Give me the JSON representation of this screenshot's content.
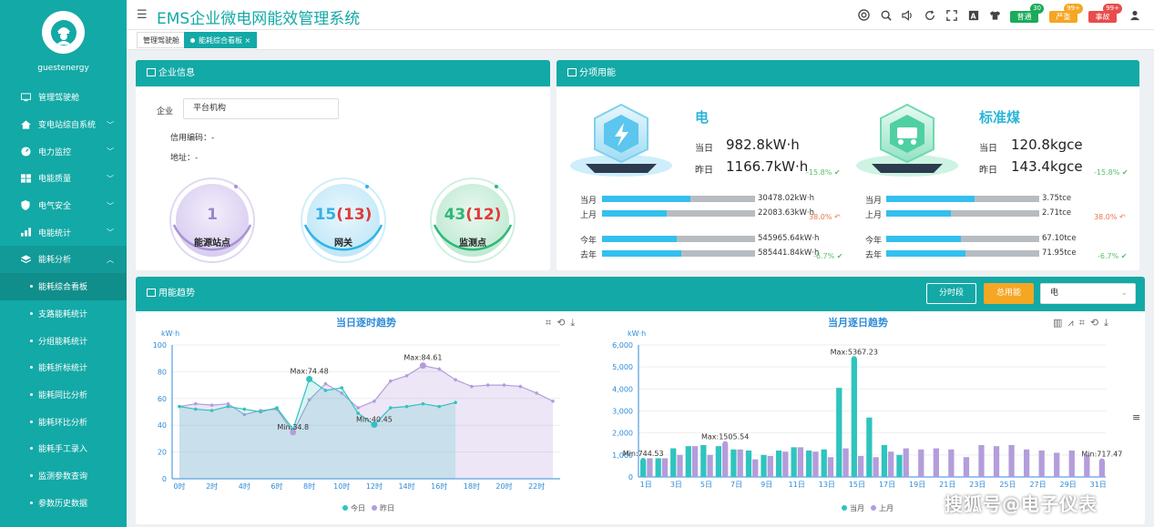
{
  "user": {
    "name": "guestenergy"
  },
  "app": {
    "title": "EMS企业微电网能效管理系统"
  },
  "topbar": {
    "badges": [
      {
        "label": "普通",
        "count": "30",
        "color": "#1aab5a",
        "count_color": "#1aab5a"
      },
      {
        "label": "严重",
        "count": "99+",
        "color": "#f5a623",
        "count_color": "#f5a623"
      },
      {
        "label": "事故",
        "count": "99+",
        "color": "#e84c4c",
        "count_color": "#e84c4c"
      }
    ]
  },
  "sidebar": {
    "items": [
      {
        "label": "管理驾驶舱",
        "icon": "monitor-icon"
      },
      {
        "label": "变电站综自系统",
        "icon": "home-icon"
      },
      {
        "label": "电力监控",
        "icon": "gauge-icon"
      },
      {
        "label": "电能质量",
        "icon": "grid-icon"
      },
      {
        "label": "电气安全",
        "icon": "shield-icon"
      },
      {
        "label": "电能统计",
        "icon": "bar-chart-icon"
      },
      {
        "label": "能耗分析",
        "icon": "layers-icon"
      }
    ],
    "subitems": [
      {
        "label": "能耗综合看板",
        "active": true
      },
      {
        "label": "支路能耗统计"
      },
      {
        "label": "分组能耗统计"
      },
      {
        "label": "能耗折标统计"
      },
      {
        "label": "能耗同比分析"
      },
      {
        "label": "能耗环比分析"
      },
      {
        "label": "能耗手工录入"
      },
      {
        "label": "监测参数查询"
      },
      {
        "label": "参数历史数据"
      }
    ]
  },
  "tabs": [
    {
      "label": "管理驾驶舱"
    },
    {
      "label": "能耗综合看板",
      "close": "×"
    }
  ],
  "company_panel": {
    "title": "企业信息",
    "company_label": "企业",
    "company_value": "平台机构",
    "credit_label": "信用编码：-",
    "address_label": "地址：-",
    "stats": [
      {
        "value": "1",
        "extra": "",
        "label": "能源站点",
        "color": "#9b86cf"
      },
      {
        "value": "15",
        "extra": "(13)",
        "label": "网关",
        "color": "#2fb3e8"
      },
      {
        "value": "43",
        "extra": "(12)",
        "label": "监测点",
        "color": "#2fb77a"
      }
    ]
  },
  "category_panel": {
    "title": "分项用能",
    "electricity": {
      "title": "电",
      "today_label": "当日",
      "today_value": "982.8kW·h",
      "yesterday_label": "昨日",
      "yesterday_value": "1166.7kW·h",
      "day_pct": "-15.8%",
      "month_label": "当月",
      "month_value": "30478.02kW·h",
      "month_fill": 0.58,
      "last_month_label": "上月",
      "last_month_value": "22083.63kW·h",
      "last_month_fill": 0.42,
      "month_pct": "38.0%",
      "year_label": "今年",
      "year_value": "545965.64kW·h",
      "year_fill": 0.49,
      "last_year_label": "去年",
      "last_year_value": "585441.84kW·h",
      "last_year_fill": 0.52,
      "year_pct": "-6.7%"
    },
    "coal": {
      "title": "标准煤",
      "today_label": "当日",
      "today_value": "120.8kgce",
      "yesterday_label": "昨日",
      "yesterday_value": "143.4kgce",
      "day_pct": "-15.8%",
      "month_label": "当月",
      "month_value": "3.75tce",
      "month_fill": 0.58,
      "last_month_label": "上月",
      "last_month_value": "2.71tce",
      "last_month_fill": 0.42,
      "month_pct": "38.0%",
      "year_label": "今年",
      "year_value": "67.10tce",
      "year_fill": 0.49,
      "last_year_label": "去年",
      "last_year_value": "71.95tce",
      "last_year_fill": 0.52,
      "year_pct": "-6.7%"
    }
  },
  "trend_panel": {
    "title": "用能趋势",
    "btn_period": "分时段",
    "btn_total": "总用能",
    "select_value": "电"
  },
  "chart_data": [
    {
      "type": "line",
      "title": "当日逐时趋势",
      "ylabel": "kW·h",
      "ylim": [
        0,
        100
      ],
      "yticks": [
        0,
        20,
        40,
        60,
        80,
        100
      ],
      "categories": [
        "0时",
        "1时",
        "2时",
        "3时",
        "4时",
        "5时",
        "6时",
        "7时",
        "8时",
        "9时",
        "10时",
        "11时",
        "12时",
        "13时",
        "14时",
        "15时",
        "16时",
        "17时",
        "18时",
        "19时",
        "20时",
        "21时",
        "22时",
        "23时"
      ],
      "xticks": [
        "0时",
        "2时",
        "4时",
        "6时",
        "8时",
        "10时",
        "12时",
        "14时",
        "16时",
        "18时",
        "20时",
        "22时"
      ],
      "series": [
        {
          "name": "今日",
          "color": "#2ec4bf",
          "values": [
            54,
            52,
            51,
            54,
            52,
            50,
            53,
            37,
            74.48,
            66,
            68,
            49,
            40.45,
            53,
            54,
            56,
            54,
            57
          ]
        },
        {
          "name": "昨日",
          "color": "#b39ddb",
          "values": [
            54,
            56,
            55,
            56,
            48,
            51,
            52,
            34.8,
            59,
            71,
            64,
            53,
            58,
            73,
            77,
            84.61,
            82,
            74,
            69,
            70,
            70,
            69,
            64,
            58
          ]
        }
      ],
      "annotations": [
        {
          "text": "Max:74.48",
          "series": "今日",
          "index": 8
        },
        {
          "text": "Min:34.8",
          "series": "昨日",
          "index": 7
        },
        {
          "text": "Min:40.45",
          "series": "今日",
          "index": 12
        },
        {
          "text": "Max:84.61",
          "series": "昨日",
          "index": 15
        }
      ],
      "legend": "bottom"
    },
    {
      "type": "bar",
      "title": "当月逐日趋势",
      "ylabel": "kW·h",
      "ylim": [
        0,
        6000
      ],
      "yticks": [
        "0",
        "1,000",
        "2,000",
        "3,000",
        "4,000",
        "5,000",
        "6,000"
      ],
      "categories": [
        "1日",
        "2日",
        "3日",
        "4日",
        "5日",
        "6日",
        "7日",
        "8日",
        "9日",
        "10日",
        "11日",
        "12日",
        "13日",
        "14日",
        "15日",
        "16日",
        "17日",
        "18日",
        "19日",
        "20日",
        "21日",
        "22日",
        "23日",
        "24日",
        "25日",
        "26日",
        "27日",
        "28日",
        "29日",
        "30日",
        "31日"
      ],
      "xticks": [
        "1日",
        "3日",
        "5日",
        "7日",
        "9日",
        "11日",
        "13日",
        "15日",
        "17日",
        "19日",
        "21日",
        "23日",
        "25日",
        "27日",
        "29日",
        "31日"
      ],
      "series": [
        {
          "name": "当月",
          "color": "#2ec4bf",
          "values": [
            744.53,
            850,
            1300,
            1400,
            1450,
            1400,
            1250,
            1200,
            1000,
            1200,
            1350,
            1200,
            1250,
            4050,
            5367.23,
            2700,
            1450,
            1000
          ]
        },
        {
          "name": "上月",
          "color": "#b39ddb",
          "values": [
            850,
            850,
            1000,
            1400,
            1000,
            1505.54,
            1250,
            800,
            950,
            1150,
            1350,
            1150,
            900,
            1300,
            950,
            900,
            1150,
            1300,
            1250,
            1300,
            1250,
            900,
            1450,
            1400,
            1450,
            1250,
            1200,
            1100,
            1200,
            1000,
            717.47
          ]
        }
      ],
      "annotations": [
        {
          "text": "Min:744.53",
          "series": "当月",
          "index": 0
        },
        {
          "text": "Max:1505.54",
          "series": "上月",
          "index": 5
        },
        {
          "text": "Max:5367.23",
          "series": "当月",
          "index": 14
        },
        {
          "text": "Min:717.47",
          "series": "上月",
          "index": 30
        }
      ],
      "legend": "bottom"
    }
  ],
  "watermark": "搜狐号@电子仪表"
}
